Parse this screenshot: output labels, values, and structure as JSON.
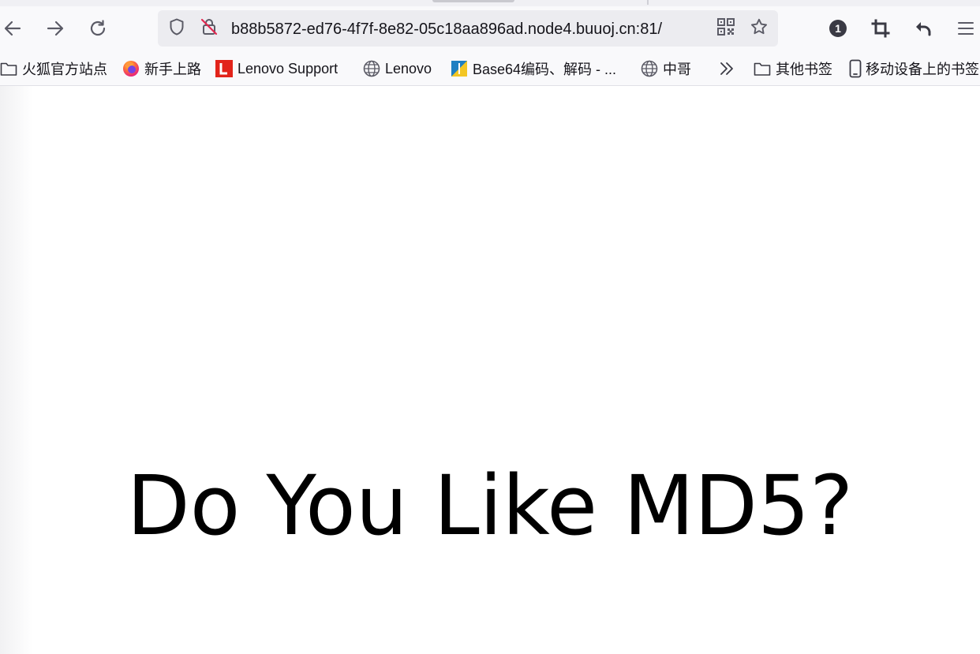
{
  "browser": {
    "url": "b88b5872-ed76-4f7f-8e82-05c18aa896ad.node4.buuoj.cn:81/",
    "toolbar_icons": [
      "back-icon",
      "forward-icon",
      "reload-icon",
      "shield-icon",
      "insecure-lock-icon",
      "qr-code-icon",
      "star-icon",
      "extension-badge-icon",
      "crop-icon",
      "undo-icon",
      "menu-icon"
    ],
    "extension_badge_count": "1",
    "colors": {
      "toolbar": "#f9f9fb",
      "urlbar": "#ececf0",
      "text": "#15141a",
      "insecure": "#e22850",
      "lenovo_red": "#e2231a"
    }
  },
  "bookmarks": {
    "items": [
      {
        "label": "火狐官方站点",
        "icon": "folder-icon"
      },
      {
        "label": "新手上路",
        "icon": "firefox-icon"
      },
      {
        "label": "Lenovo Support",
        "icon": "lenovo-icon"
      },
      {
        "label": "Lenovo",
        "icon": "globe-icon"
      },
      {
        "label": "Base64编码、解码 - ...",
        "icon": "base64-site-icon"
      },
      {
        "label": "中哥",
        "icon": "globe-icon"
      }
    ],
    "overflow_icon": "chevron-double-right-icon",
    "other_bookmarks": {
      "label": "其他书签",
      "icon": "folder-icon"
    },
    "mobile_bookmarks": {
      "label": "移动设备上的书签",
      "icon": "mobile-device-icon"
    }
  },
  "page": {
    "headline": "Do You Like MD5?"
  }
}
